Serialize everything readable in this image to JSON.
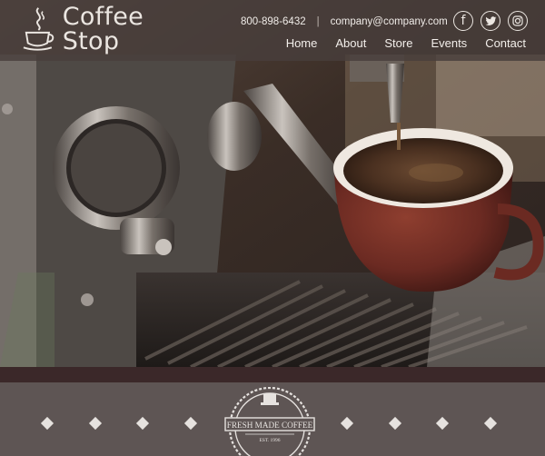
{
  "brand": {
    "name": "Coffee Stop"
  },
  "header": {
    "phone": "800-898-6432",
    "separator": "|",
    "email": "company@company.com"
  },
  "social": [
    {
      "icon": "facebook-icon",
      "label": "f"
    },
    {
      "icon": "twitter-icon"
    },
    {
      "icon": "instagram-icon"
    }
  ],
  "nav": {
    "items": [
      "Home",
      "About",
      "Store",
      "Events",
      "Contact"
    ]
  },
  "badge": {
    "text": "FRESH MADE COFFEE",
    "est": "EST. 1996"
  },
  "colors": {
    "header_bg": "#483e3c",
    "strip": "#3b2829",
    "band": "#5e5554",
    "text_light": "#f3efeb"
  }
}
